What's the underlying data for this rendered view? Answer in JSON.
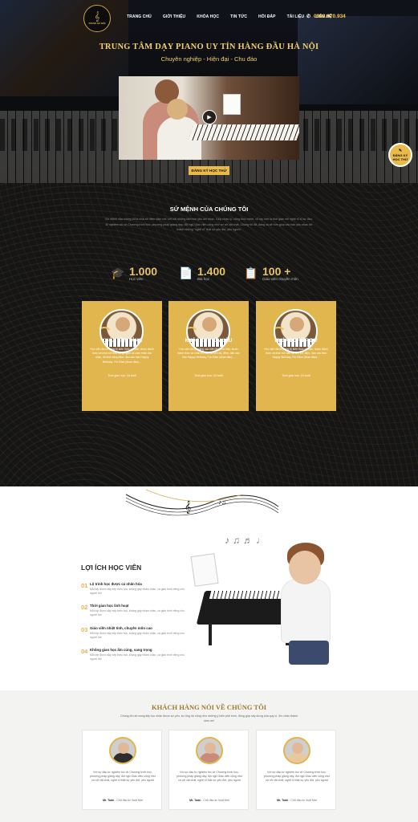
{
  "brand": {
    "logo_mark": "𝄞",
    "logo_text": "PIANO HÀ NỘI"
  },
  "nav": {
    "items": [
      "TRANG CHỦ",
      "GIỚI THIỆU",
      "KHÓA HỌC",
      "TIN TỨC",
      "HỎI ĐÁP",
      "TÀI LIỆU",
      "LIÊN HỆ"
    ],
    "phone": "0962.070.934",
    "phone_icon": "phone-icon"
  },
  "hero": {
    "title": "TRUNG TÂM DẠY PIANO UY TÍN HÀNG ĐẦU HÀ NỘI",
    "subtitle": "Chuyên nghiệp - Hiện đại - Chu đáo",
    "play_icon": "▶",
    "cta": "ĐĂNG KÝ HỌC THỬ"
  },
  "floating_register": {
    "icon": "✎",
    "line1": "ĐĂNG KÝ",
    "line2": "HỌC THỬ"
  },
  "mission": {
    "title": "SỨ MỆNH CỦA CHÚNG TÔI",
    "description": "Sứ mệnh của chúng tôi là chia sẻ niềm đam mê, kết nối những tâm hồn yêu âm nhạc. Giúp nhạc lý, vững thực hành, vỗ tay hơn là thời gian với nghệ sĩ kĩ sự đầu, từ nghiệm lục về Chương trình học, phương pháp giảng dạy, đội ngũ Giáo viên cũng như cơ sở vật chất. Chúng tôi đã, đang và sẽ hơn giúp các bạn yêu nhạc trở thành những \"nghệ sĩ\" thật sự yêu đời, yêu người."
  },
  "stats": [
    {
      "icon": "graduation-cap-icon",
      "glyph": "🎓",
      "value": "1.000",
      "label": "Học viên"
    },
    {
      "icon": "document-icon",
      "glyph": "📄",
      "value": "1.400",
      "label": "Bài học"
    },
    {
      "icon": "checklist-icon",
      "glyph": "📋",
      "value": "100 +",
      "label": "Giáo viên chuyên môn"
    }
  ],
  "courses": [
    {
      "title": "KHÓA NỀN TẢNG",
      "text": "Học viên được trang bị kiến thức cơ bản, được đánh thức và khai mở khả năng nghe và cảm nhận âm nhạc, đủ khả năng đệm, đàn các bản Happy Birthday, Für Elise (đoạn đầu)…",
      "time": "Thời gian học: 24 buổi"
    },
    {
      "title": "KHÓA CHUYÊN SÂU",
      "text": "Học viên được nâng cao kiến thức cơ bản, được đánh thức và khai mở các độ tiến bộ, đệm, đàn các bản Happy Birthday, Für Elise (đoạn đầu)…",
      "time": "Thời gian học: 24 buổi"
    },
    {
      "title": "KHÓA NGHIỆP DƯ",
      "text": "Học viên được trang bị kiến thức cơ bản, được đánh thức và khai mở các độ tiến bộ, đệm, đàn các bản Happy Birthday, Für Elise (đoạn đầu)…",
      "time": "Thời gian học: 24 buổi"
    }
  ],
  "benefits": {
    "title": "LỢI ÍCH HỌC VIÊN",
    "items": [
      {
        "num": "01",
        "title": "Lộ trình học được cá nhân hóa",
        "desc": "Mỗi lớp được sắp xếp theo học, không gây nhàm chán, cá giáo trình riêng cho người lớn"
      },
      {
        "num": "02",
        "title": "Thời gian học linh hoạt",
        "desc": "Mỗi lớp được sắp xếp theo học, không gây nhàm chán, cá giáo trình riêng cho người lớn"
      },
      {
        "num": "03",
        "title": "Giáo viên nhiệt tình, chuyên môn cao",
        "desc": "Mỗi lớp được sắp xếp theo học, không gây nhàm chán, cá giáo trình riêng cho người lớn"
      },
      {
        "num": "04",
        "title": "Không gian học ấm cúng, sang trọng",
        "desc": "Mỗi lớp được sắp xếp theo học, không gây nhàm chán, cá giáo trình riêng cho người lớn"
      }
    ]
  },
  "testimonials": {
    "title": "KHÁCH HÀNG NÓI VỀ CHÚNG TÔI",
    "intro": "Chúng tôi rất mong tiếp tục nhận được sự yêu, sự ủng hộ cũng như những ý kiến phê bình, đóng góp xây dựng của quý vị. Xin chân thành cảm ơn!",
    "items": [
      {
        "text": "Với sự đầu tư nghiêm túc về Chương trình học, phương pháp giảng dạy, đội ngũ Giáo viên cũng như cơ sở vật chất, nghệ sĩ thật sự yêu đời, yêu người",
        "name": "Mr. Tuấn",
        "role": " - Chủ đầu tư Vuột Mơi"
      },
      {
        "text": "Với sự đầu tư nghiêm túc về Chương trình học, phương pháp giảng dạy, đội ngũ Giáo viên cũng như cơ sở vật chất, nghệ sĩ thật sự yêu đời, yêu người",
        "name": "Mr. Tuấn",
        "role": " - Chủ đầu tư Vuột Mơi"
      },
      {
        "text": "Với sự đầu tư nghiêm túc về Chương trình học, phương pháp giảng dạy, đội ngũ Giáo viên cũng như cơ sở vật chất, nghệ sĩ thật sự yêu đời, yêu người",
        "name": "Mr. Tuấn",
        "role": " - Chủ đầu tư Vuột Mơi"
      }
    ]
  },
  "colors": {
    "gold": "#e1b64e",
    "dark": "#151515",
    "accent_text": "#f1cf6e"
  }
}
